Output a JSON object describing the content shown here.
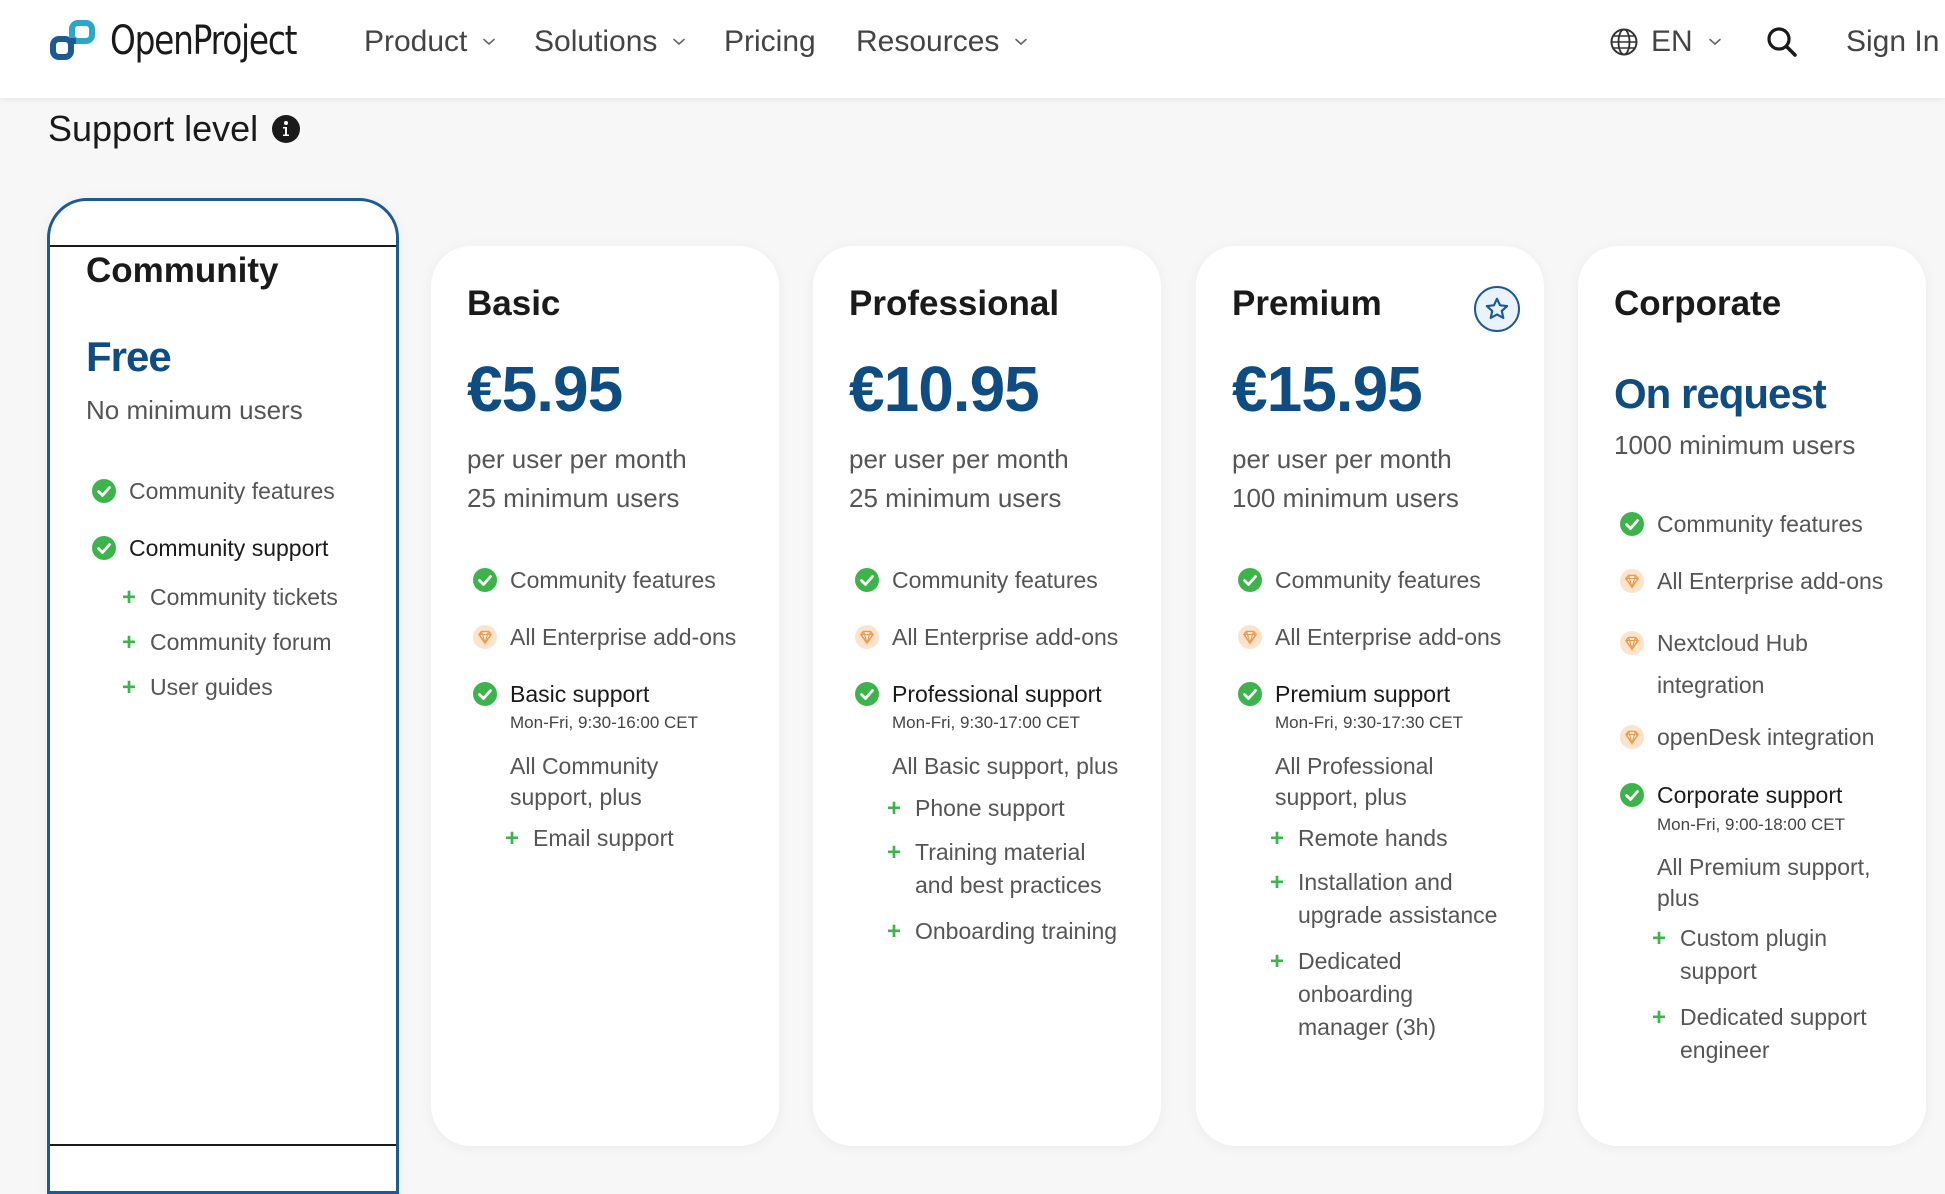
{
  "header": {
    "logo_text": "OpenProject",
    "nav": {
      "product": "Product",
      "solutions": "Solutions",
      "pricing": "Pricing",
      "resources": "Resources"
    },
    "language": "EN",
    "sign_in": "Sign In"
  },
  "section": {
    "title": "Support level"
  },
  "colors": {
    "brand_blue": "#0f4c81",
    "check_green": "#3cb44b",
    "addon_orange": "#f0a05a"
  },
  "plans": {
    "community": {
      "name": "Community",
      "price": "Free",
      "min_users": "No minimum users",
      "features": [
        "Community features",
        "Community support"
      ],
      "extras": [
        "Community tickets",
        "Community forum",
        "User guides"
      ]
    },
    "basic": {
      "name": "Basic",
      "price": "€5.95",
      "per": "per user per month",
      "min_users": "25 minimum users",
      "features": [
        "Community features",
        "All Enterprise add-ons"
      ],
      "support": "Basic support",
      "hours": "Mon-Fri, 9:30-16:00 CET",
      "includes": "All Community support, plus",
      "extras": [
        "Email support"
      ]
    },
    "professional": {
      "name": "Professional",
      "price": "€10.95",
      "per": "per user per month",
      "min_users": "25 minimum users",
      "features": [
        "Community features",
        "All Enterprise add-ons"
      ],
      "support": "Professional support",
      "hours": "Mon-Fri, 9:30-17:00 CET",
      "includes": "All Basic support, plus",
      "extras": [
        "Phone support",
        "Training material and best practices",
        "Onboarding training"
      ]
    },
    "premium": {
      "name": "Premium",
      "price": "€15.95",
      "per": "per user per month",
      "min_users": "100 minimum users",
      "features": [
        "Community features",
        "All Enterprise add-ons"
      ],
      "support": "Premium support",
      "hours": "Mon-Fri, 9:30-17:30 CET",
      "includes": "All Professional support, plus",
      "extras": [
        "Remote hands",
        "Installation and upgrade assistance",
        "Dedicated onboarding manager (3h)"
      ]
    },
    "corporate": {
      "name": "Corporate",
      "price": "On request",
      "min_users": "1000 minimum users",
      "features": [
        "Community features",
        "All Enterprise add-ons",
        "Nextcloud Hub integration",
        "openDesk integration"
      ],
      "support": "Corporate support",
      "hours": "Mon-Fri, 9:00-18:00 CET",
      "includes": "All Premium support, plus",
      "extras": [
        "Custom plugin support",
        "Dedicated support engineer"
      ]
    }
  }
}
